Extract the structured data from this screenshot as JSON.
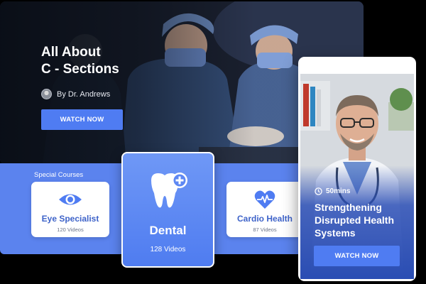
{
  "hero": {
    "title": "All About\nC - Sections",
    "author": "By Dr. Andrews",
    "cta_label": "WATCH NOW"
  },
  "courses": {
    "label": "Special Courses",
    "items": [
      {
        "title": "Eye Specialist",
        "count": "120 Videos",
        "icon": "eye-icon"
      },
      {
        "title": "Dental",
        "count": "128 Videos",
        "icon": "tooth-plus-icon"
      },
      {
        "title": "Cardio Health",
        "count": "87 Videos",
        "icon": "heart-pulse-icon"
      }
    ]
  },
  "featured": {
    "duration": "50mins",
    "title": "Strengthening\nDisrupted Health\nSystems",
    "cta_label": "WATCH NOW"
  },
  "colors": {
    "accent": "#4f7cf2",
    "strip": "#5b83ee",
    "course_title": "#3e63c9",
    "background": "#000000"
  }
}
